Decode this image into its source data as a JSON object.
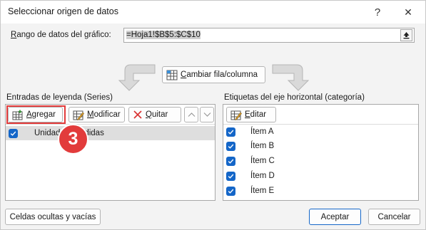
{
  "dialog": {
    "title": "Seleccionar origen de datos",
    "help_symbol": "?",
    "close_symbol": "✕"
  },
  "range": {
    "label_prefix": "R",
    "label_rest": "ango de datos del gráfico:",
    "value": "=Hoja1!$B$5:$C$10"
  },
  "switch_button": {
    "label_prefix": "C",
    "label_rest": "ambiar fila/columna"
  },
  "series_panel": {
    "label": "Entradas de leyenda (Series)",
    "add_prefix": "A",
    "add_rest": "gregar",
    "modify_prefix": "M",
    "modify_rest": "odificar",
    "remove_prefix": "Q",
    "remove_rest": "uitar",
    "items": [
      {
        "label": "Unidades vendidas",
        "checked": true
      }
    ]
  },
  "category_panel": {
    "label": "Etiquetas del eje horizontal (categoría)",
    "edit_prefix": "E",
    "edit_rest": "ditar",
    "items": [
      {
        "label": "Ítem A",
        "checked": true
      },
      {
        "label": "Ítem B",
        "checked": true
      },
      {
        "label": "Ítem C",
        "checked": true
      },
      {
        "label": "Ítem D",
        "checked": true
      },
      {
        "label": "Ítem E",
        "checked": true
      }
    ]
  },
  "step_badge": "3",
  "footer": {
    "hidden_cells": "Celdas ocultas y vacías",
    "accept": "Aceptar",
    "cancel": "Cancelar"
  },
  "colors": {
    "accent": "#1466c8",
    "badge": "#e23b3b"
  }
}
